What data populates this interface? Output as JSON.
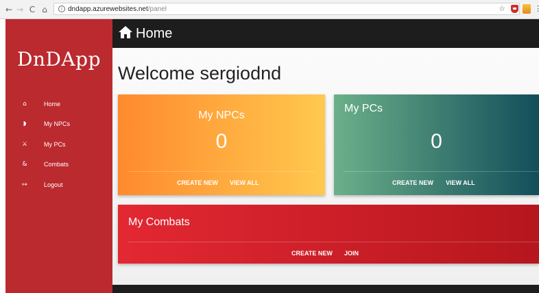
{
  "browser": {
    "url_host": "dndapp.azurewebsites.net",
    "url_path": "/panel",
    "nav_back": "←",
    "nav_forward": "→",
    "nav_reload": "C",
    "nav_home": "⌂",
    "info_glyph": "i",
    "star_glyph": "☆",
    "menu_glyph": "⋮"
  },
  "sidebar": {
    "brand": "DnDApp",
    "bg_color": "#bb2a2f",
    "items": [
      {
        "label": "Home",
        "icon": "home-icon",
        "glyph": "⌂"
      },
      {
        "label": "My NPCs",
        "icon": "shield-icon",
        "glyph": "◗"
      },
      {
        "label": "My PCs",
        "icon": "sword-icon",
        "glyph": "⚔"
      },
      {
        "label": "Combats",
        "icon": "ampersand-icon",
        "glyph": "&"
      },
      {
        "label": "Logout",
        "icon": "logout-icon",
        "glyph": "↦"
      }
    ]
  },
  "topbar": {
    "title": "Home",
    "icon": "home-icon"
  },
  "main": {
    "welcome": "Welcome sergiodnd"
  },
  "cards": {
    "npcs": {
      "title": "My NPCs",
      "count": "0",
      "create_label": "CREATE NEW",
      "view_label": "VIEW ALL",
      "colors": [
        "#ff8a2e",
        "#ffc94e"
      ]
    },
    "pcs": {
      "title": "My PCs",
      "count": "0",
      "create_label": "CREATE NEW",
      "view_label": "VIEW ALL",
      "colors": [
        "#6bb08a",
        "#124e5a"
      ]
    },
    "combats": {
      "title": "My Combats",
      "create_label": "CREATE NEW",
      "join_label": "JOIN",
      "colors": [
        "#e32832",
        "#b6161e"
      ]
    }
  }
}
